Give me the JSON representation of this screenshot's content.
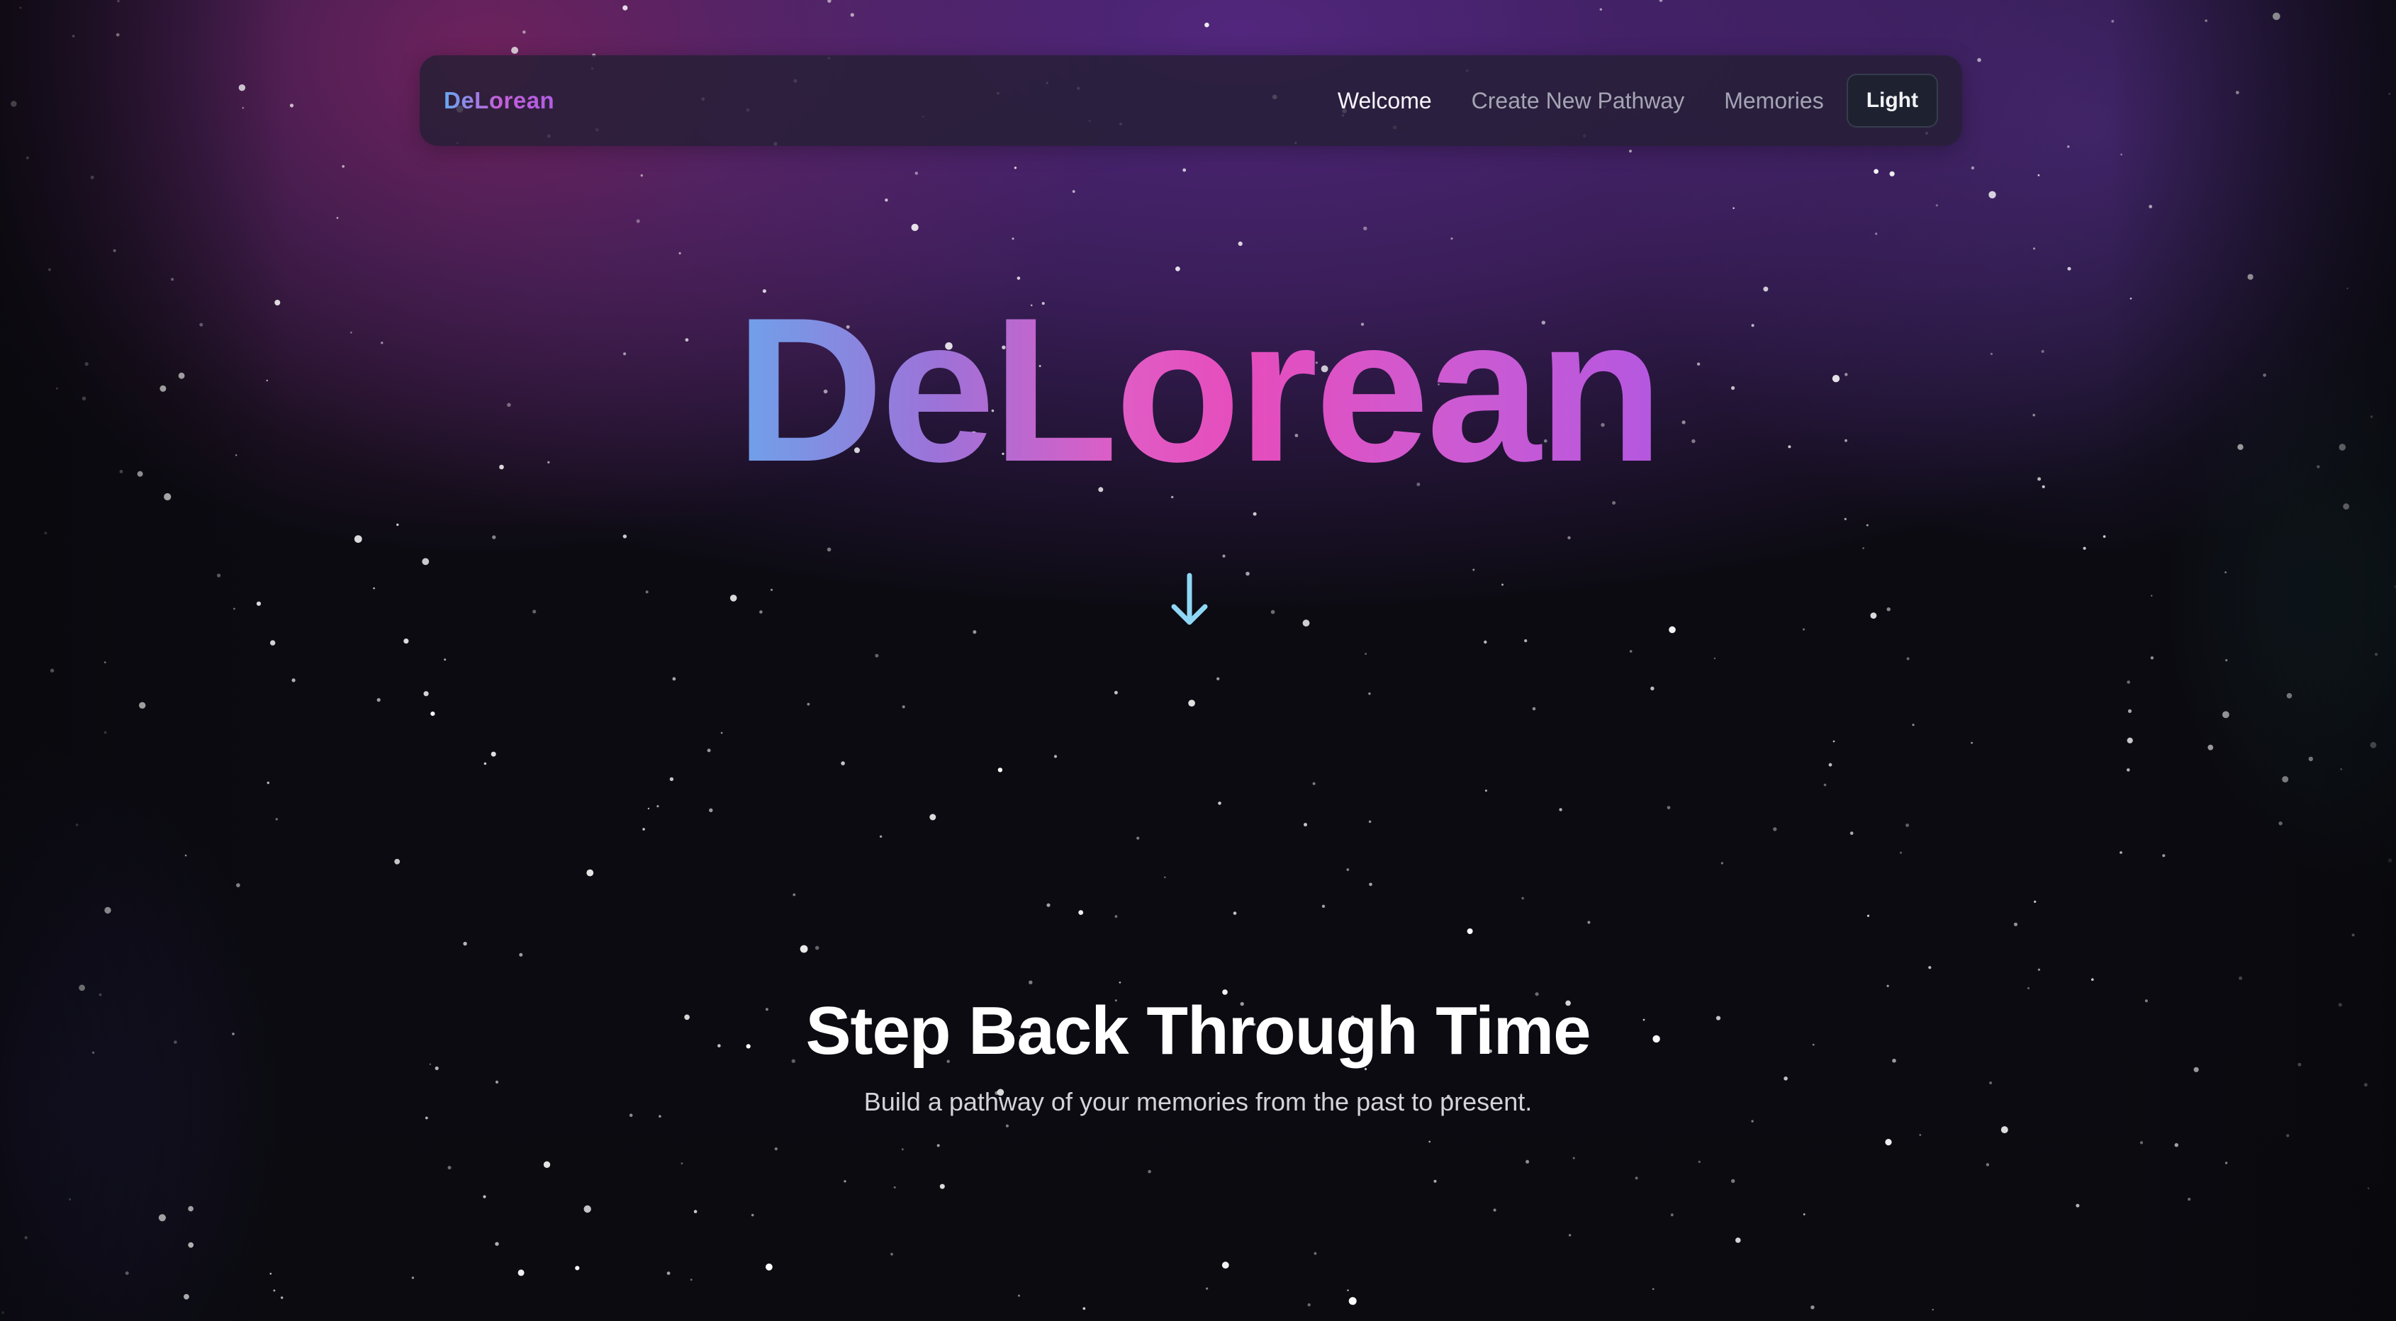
{
  "navbar": {
    "brand": "DeLorean",
    "links": [
      {
        "label": "Welcome",
        "active": true
      },
      {
        "label": "Create New Pathway",
        "active": false
      },
      {
        "label": "Memories",
        "active": false
      }
    ],
    "theme_toggle_label": "Light"
  },
  "hero": {
    "title": "DeLorean",
    "scroll_icon": "arrow-down-icon"
  },
  "section": {
    "title": "Step Back Through Time",
    "subtitle": "Build a pathway of your memories from the past to present."
  },
  "colors": {
    "accent_blue": "#6ea2ea",
    "accent_pink": "#e64cbc",
    "accent_purple": "#b458e0",
    "arrow": "#8fd6f5",
    "background": "#0b0b10"
  }
}
